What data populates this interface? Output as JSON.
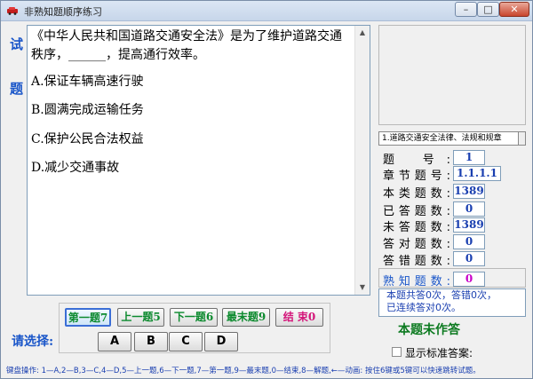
{
  "window": {
    "title": "非熟知题顺序练习",
    "controls": {
      "minimize": "–",
      "maximize": "□",
      "close": "✕"
    }
  },
  "question": {
    "side_label_top": "试",
    "side_label_bottom": "题",
    "text": "《中华人民共和国道路交通安全法》是为了维护道路交通秩序，______，提高通行效率。",
    "options": [
      "A.保证车辆高速行驶",
      "B.圆满完成运输任务",
      "C.保护公民合法权益",
      "D.减少交通事故"
    ]
  },
  "chapter": "1.道路交通安全法律、法规和规章",
  "stats": [
    {
      "label": "题  号:",
      "value": "1"
    },
    {
      "label": "章节题号:",
      "value": "1.1.1.1"
    },
    {
      "label": "本类题数:",
      "value": "1389"
    },
    {
      "label": "已答题数:",
      "value": "0"
    },
    {
      "label": "未答题数:",
      "value": "1389"
    },
    {
      "label": "答对题数:",
      "value": "0"
    },
    {
      "label": "答错题数:",
      "value": "0"
    },
    {
      "label": "熟知题数:",
      "value": "0"
    }
  ],
  "info": {
    "line1": "本题共答0次，答错0次，",
    "line2": "已连续答对0次。"
  },
  "status": "本题未作答",
  "show_answer_label": "显示标准答案:",
  "show_answer_checked": false,
  "choose_label": "请选择:",
  "nav_buttons": [
    "第一题7",
    "上一题5",
    "下一题6",
    "最末题9",
    "结 束0"
  ],
  "answer_buttons": [
    "A",
    "B",
    "C",
    "D"
  ],
  "footer": "键盘操作: 1—A,2—B,3—C,4—D,5—上一题,6—下一题,7—第一题,9—最末题,0—结束,8—解题,←—动画: 按住6键或5键可以快速跳转试题。",
  "colors": {
    "accent_blue": "#1a56c9",
    "value_blue": "#1a3fb0",
    "nav_green": "#0c8a2e",
    "end_pink": "#d4157a",
    "known_magenta": "#c800c8",
    "status_green": "#0c7a20"
  }
}
